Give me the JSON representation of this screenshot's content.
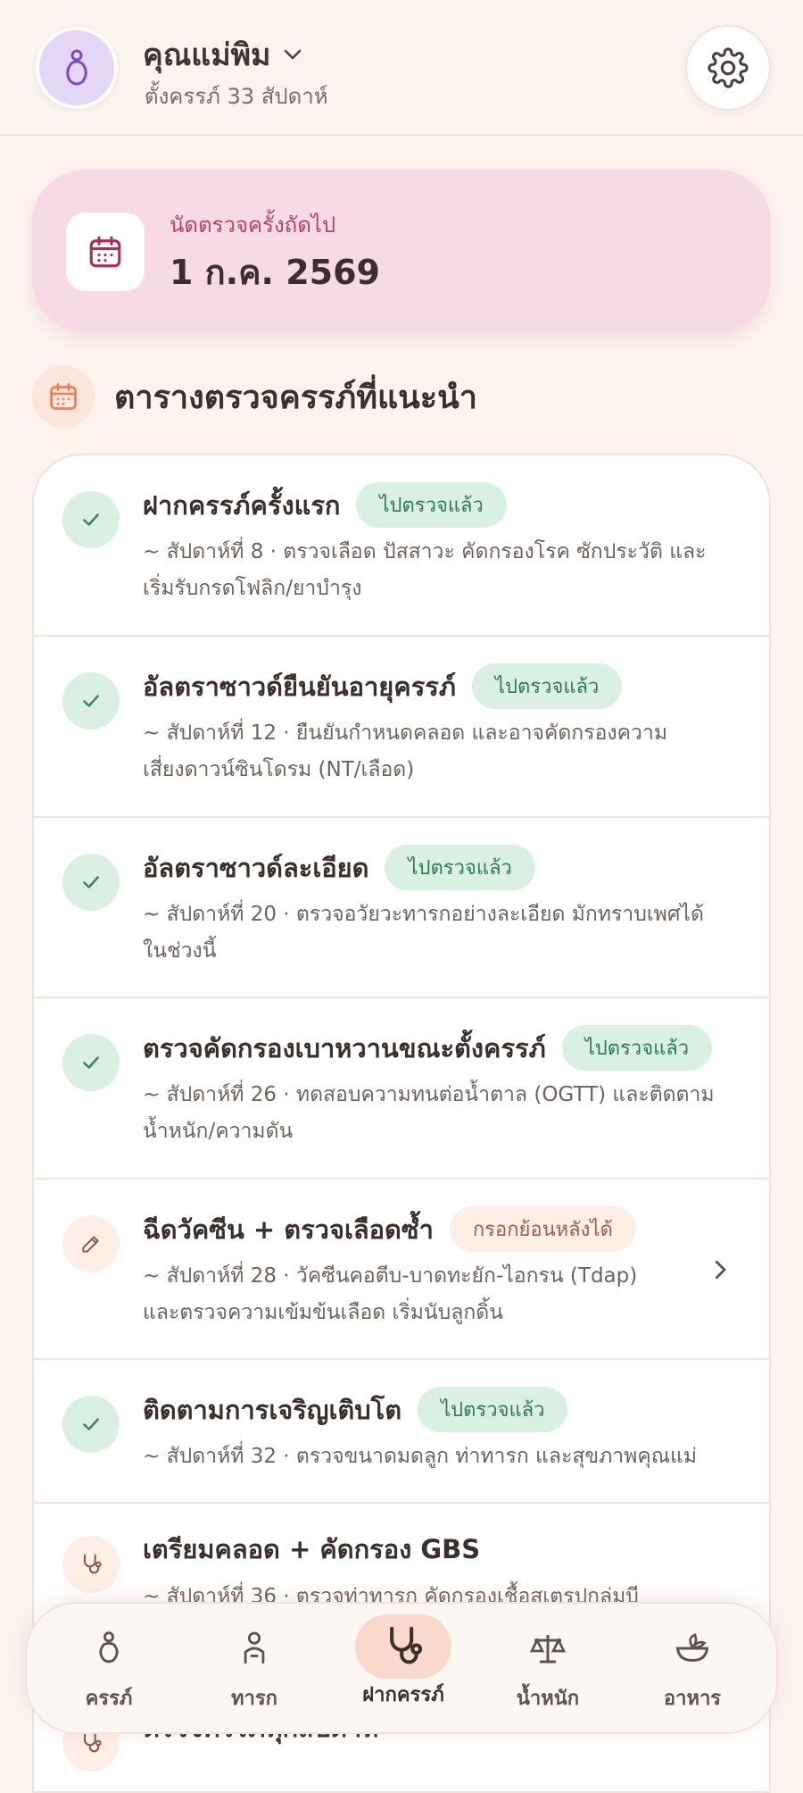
{
  "header": {
    "profile_name": "คุณแม่พิม",
    "profile_subtitle": "ตั้งครรภ์ 33 สัปดาห์",
    "icons": {
      "avatar": "pregnant-mother-icon",
      "dropdown": "chevron-down-icon",
      "settings": "gear-icon"
    }
  },
  "appointment": {
    "label": "นัดตรวจครั้งถัดไป",
    "date": "1 ก.ค. 2569",
    "icon": "calendar-icon"
  },
  "section": {
    "title": "ตารางตรวจครรภ์ที่แนะนำ",
    "icon": "calendar-icon"
  },
  "checkups": [
    {
      "title": "ฝากครรภ์ครั้งแรก",
      "badge": "ไปตรวจแล้ว",
      "status": "done",
      "line1": "~ สัปดาห์ที่ 8 · ตรวจเลือด ปัสสาวะ คัดกรองโรค ซักประวัติ และ",
      "line2": "เริ่มรับกรดโฟลิก/ยาบำรุง"
    },
    {
      "title": "อัลตราซาวด์ยืนยันอายุครรภ์",
      "badge": "ไปตรวจแล้ว",
      "status": "done",
      "line1": "~ สัปดาห์ที่ 12 · ยืนยันกำหนดคลอด และอาจคัดกรองความ",
      "line2": "เสี่ยงดาวน์ซินโดรม (NT/เลือด)"
    },
    {
      "title": "อัลตราซาวด์ละเอียด",
      "badge": "ไปตรวจแล้ว",
      "status": "done",
      "line1": "~ สัปดาห์ที่ 20 · ตรวจอวัยวะทารกอย่างละเอียด มักทราบเพศได้",
      "line2": "ในช่วงนี้"
    },
    {
      "title": "ตรวจคัดกรองเบาหวานขณะตั้งครรภ์",
      "badge": "ไปตรวจแล้ว",
      "status": "done",
      "line1": "~ สัปดาห์ที่ 26 · ทดสอบความทนต่อน้ำตาล (OGTT) และติดตาม",
      "line2": "น้ำหนัก/ความดัน"
    },
    {
      "title": "ฉีดวัคซีน + ตรวจเลือดซ้ำ",
      "badge": "กรอกย้อนหลังได้",
      "status": "late",
      "line1": "~ สัปดาห์ที่ 28 · วัคซีนคอตีบ-บาดทะยัก-ไอกรน (Tdap)",
      "line2": "และตรวจความเข้มข้นเลือด เริ่มนับลูกดิ้น"
    },
    {
      "title": "ติดตามการเจริญเติบโต",
      "badge": "ไปตรวจแล้ว",
      "status": "done",
      "line1": "~ สัปดาห์ที่ 32 · ตรวจขนาดมดลูก ท่าทารก และสุขภาพคุณแม่",
      "line2": ""
    },
    {
      "title": "เตรียมคลอด + คัดกรอง GBS",
      "badge": "",
      "status": "pending",
      "line1": "~ สัปดาห์ที่ 36 · ตรวจท่าทารก คัดกรองเชื้อสเตรปกลุ่มบี",
      "line2": ""
    },
    {
      "title": "ตรวจครรภ์ทุกสัปดาห์",
      "badge": "",
      "status": "pending",
      "line1": "",
      "line2": ""
    }
  ],
  "nav": {
    "items": [
      {
        "label": "ครรภ์",
        "icon": "pregnancy-icon"
      },
      {
        "label": "ทารก",
        "icon": "baby-icon"
      },
      {
        "label": "ฝากครรภ์",
        "icon": "stethoscope-icon",
        "active": true
      },
      {
        "label": "น้ำหนัก",
        "icon": "scale-icon"
      },
      {
        "label": "อาหาร",
        "icon": "food-bowl-icon"
      }
    ]
  },
  "colors": {
    "background": "#fcf3ef",
    "appointment_card": "#f8d9e6",
    "done_badge": "#d9f0e3",
    "late_badge": "#fdeee6",
    "nav_active": "#fad8cb"
  }
}
